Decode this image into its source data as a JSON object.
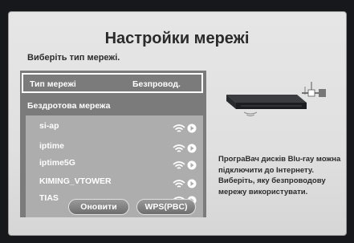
{
  "dialog": {
    "title": "Настройки мережі",
    "subtitle": "Виберіть тип мережі."
  },
  "network_type": {
    "label": "Тип мережі",
    "value": "Безпровод."
  },
  "wireless": {
    "heading": "Бездротова мережа",
    "networks": [
      {
        "name": "si-ap"
      },
      {
        "name": "iptime"
      },
      {
        "name": "iptime5G"
      },
      {
        "name": "KIMING_VTOWER"
      },
      {
        "name": "TIAS"
      }
    ],
    "signal_icon": "wifi-signal-icon",
    "select_icon": "arrow-right-icon",
    "scroll_icon": "chevron-down-icon"
  },
  "buttons": {
    "refresh": "Оновити",
    "wps": "WPS(PBC)"
  },
  "description": "ПрограВач дисків Blu-ray можна підключити до Інтернету. Виберіть, яку безпроводову мережу використувати.",
  "colors": {
    "panel": "#e0e0e0",
    "list_bg": "#adadad",
    "left_bg": "#7b7b7b",
    "text_dark": "#2b2b2b",
    "text_light": "#ffffff"
  }
}
